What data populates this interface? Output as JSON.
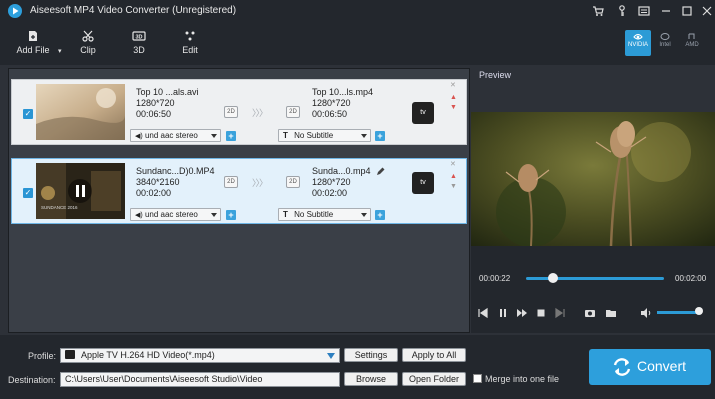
{
  "window": {
    "title": "Aiseesoft MP4 Video Converter (Unregistered)"
  },
  "toolbar": {
    "add_file": "Add File",
    "clip": "Clip",
    "threed": "3D",
    "edit": "Edit"
  },
  "gpu": {
    "nvidia": "NVIDIA",
    "intel": "Intel",
    "amd": "AMD"
  },
  "files": [
    {
      "src_name": "Top 10 ...als.avi",
      "src_res": "1280*720",
      "src_dur": "00:06:50",
      "dst_name": "Top 10...ls.mp4",
      "dst_res": "1280*720",
      "dst_dur": "00:06:50",
      "audio": "und aac stereo",
      "subtitle": "No Subtitle",
      "badge": "2D",
      "device": "tv"
    },
    {
      "src_name": "Sundanc...D)0.MP4",
      "src_res": "3840*2160",
      "src_dur": "00:02:00",
      "dst_name": "Sunda...0.mp4",
      "dst_res": "1280*720",
      "dst_dur": "00:02:00",
      "audio": "und aac stereo",
      "subtitle": "No Subtitle",
      "badge": "2D",
      "device": "tv",
      "thumb_caption": "SUNDANCE 2016"
    }
  ],
  "preview": {
    "label": "Preview",
    "time_current": "00:00:22",
    "time_total": "00:02:00",
    "progress": 0.18,
    "volume": 0.85
  },
  "bottom": {
    "profile_label": "Profile:",
    "profile_value": "Apple TV H.264 HD Video(*.mp4)",
    "settings": "Settings",
    "apply_all": "Apply to All",
    "destination_label": "Destination:",
    "destination_value": "C:\\Users\\User\\Documents\\Aiseesoft Studio\\Video",
    "browse": "Browse",
    "open_folder": "Open Folder",
    "merge": "Merge into one file",
    "convert": "Convert"
  },
  "colors": {
    "accent": "#2d9fdc",
    "bg_dark": "#23272d",
    "pane": "#3a3f47"
  }
}
